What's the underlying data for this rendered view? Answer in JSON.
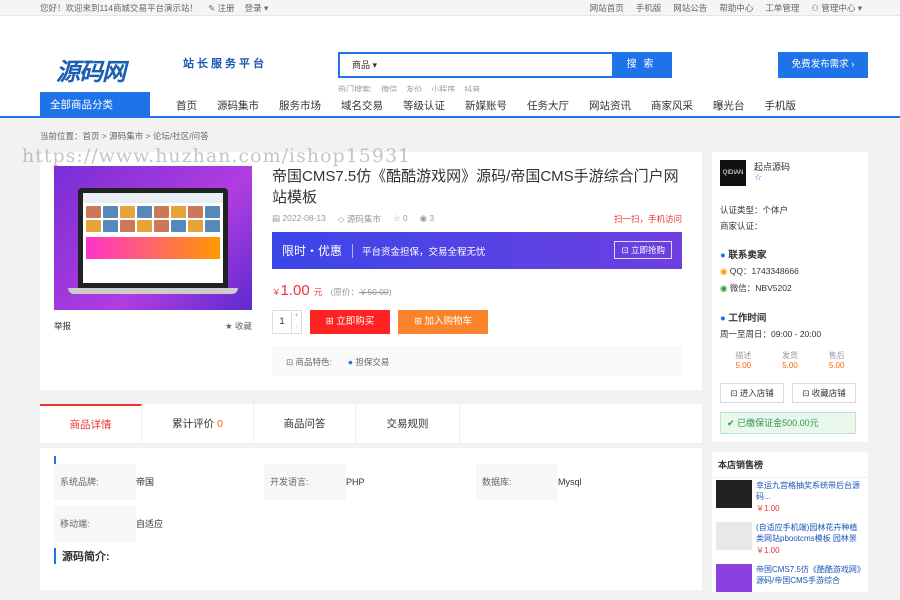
{
  "topbar": {
    "welcome": "您好！欢迎来到114商城交易平台演示站！",
    "register": "注册",
    "login": "登录",
    "links": [
      "网站首页",
      "手机版",
      "网站公告",
      "帮助中心",
      "工单管理",
      "管理中心"
    ]
  },
  "header": {
    "logo": "源码网",
    "slogan": "站长服务平台",
    "search_category": "商品",
    "search_button": "搜 索",
    "hot_label": "热门搜索:",
    "hot": [
      "微信",
      "友价",
      "小程序",
      "抖音"
    ],
    "publish": "免费发布需求"
  },
  "nav": {
    "all": "全部商品分类",
    "items": [
      "首页",
      "源码集市",
      "服务市场",
      "域名交易",
      "等级认证",
      "新媒账号",
      "任务大厅",
      "网站资讯",
      "商家风采",
      "曝光台",
      "手机版"
    ]
  },
  "breadcrumb": "当前位置：首页 > 源码集市 > 论坛/社区/问答",
  "watermark": "https://www.huzhan.com/ishop15931",
  "product": {
    "title": "帝国CMS7.5仿《酷酷游戏网》源码/帝国CMS手游综合门户网站模板",
    "date": "2022-08-13",
    "category": "源码集市",
    "likes": "0",
    "views": "3",
    "scan": "扫一扫，手机访问",
    "report": "举报",
    "favorite": "收藏",
    "promo_title": "限时・优惠",
    "promo_desc": "平台资金担保，交易全程无忧",
    "promo_buy": "立即抢购",
    "price_symbol": "￥",
    "price": "1.00",
    "price_unit": "元",
    "orig_label": "(原价：",
    "orig": "￥50.00",
    "qty": "1",
    "buy_now": "立即购买",
    "add_cart": "加入购物车",
    "feature_label": "商品特色:",
    "feature": "担保交易"
  },
  "shop": {
    "name": "起点源码",
    "logo_text": "QIDIAN",
    "cert_type": "认证类型：个体户",
    "cert_biz": "商家认证：",
    "contact_title": "联系卖家",
    "qq": "QQ：1743348666",
    "wechat": "微信：NBV5202",
    "hours_title": "工作时间",
    "hours": "周一至周日：09:00 - 20:00",
    "stats": [
      {
        "label": "描述",
        "value": "5.00"
      },
      {
        "label": "发货",
        "value": "5.00"
      },
      {
        "label": "售后",
        "value": "5.00"
      }
    ],
    "enter": "进入店铺",
    "collect": "收藏店铺",
    "deposit": "已缴保证金500.00元"
  },
  "rank": {
    "title": "本店销售榜",
    "items": [
      {
        "title": "幸运九宫格抽奖系统带后台源码...",
        "price": "￥1.00"
      },
      {
        "title": "(自适应手机端)园林花卉种植类网站pbootcms模板 园林景",
        "price": "￥1.00"
      },
      {
        "title": "帝国CMS7.5仿《酷酷游戏网》源码/帝国CMS手游综合",
        "price": ""
      }
    ]
  },
  "tabs": [
    {
      "label": "商品详情",
      "count": ""
    },
    {
      "label": "累计评价",
      "count": "0"
    },
    {
      "label": "商品问答",
      "count": ""
    },
    {
      "label": "交易规则",
      "count": ""
    }
  ],
  "specs": [
    {
      "k": "系统品牌:",
      "v": "帝国"
    },
    {
      "k": "开发语言:",
      "v": "PHP"
    },
    {
      "k": "数据库:",
      "v": "Mysql"
    },
    {
      "k": "移动端:",
      "v": "自适应"
    }
  ],
  "intro_title": "源码简介:",
  "colors": {
    "accent": "#1e73e8",
    "red": "#ff2222",
    "orange": "#f9842c"
  }
}
